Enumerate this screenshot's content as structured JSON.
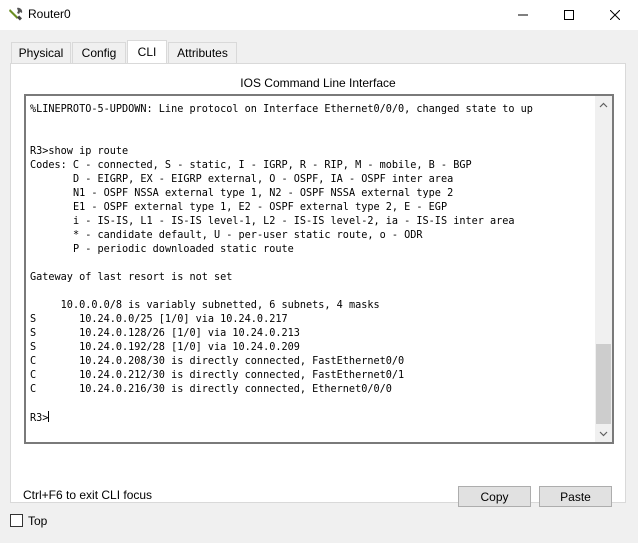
{
  "window": {
    "title": "Router0"
  },
  "tabs": [
    {
      "label": "Physical"
    },
    {
      "label": "Config"
    },
    {
      "label": "CLI"
    },
    {
      "label": "Attributes"
    }
  ],
  "active_tab": "CLI",
  "panel": {
    "title": "IOS Command Line Interface"
  },
  "terminal": {
    "output": "%LINEPROTO-5-UPDOWN: Line protocol on Interface Ethernet0/0/0, changed state to up\n\n\nR3>show ip route\nCodes: C - connected, S - static, I - IGRP, R - RIP, M - mobile, B - BGP\n       D - EIGRP, EX - EIGRP external, O - OSPF, IA - OSPF inter area\n       N1 - OSPF NSSA external type 1, N2 - OSPF NSSA external type 2\n       E1 - OSPF external type 1, E2 - OSPF external type 2, E - EGP\n       i - IS-IS, L1 - IS-IS level-1, L2 - IS-IS level-2, ia - IS-IS inter area\n       * - candidate default, U - per-user static route, o - ODR\n       P - periodic downloaded static route\n\nGateway of last resort is not set\n\n     10.0.0.0/8 is variably subnetted, 6 subnets, 4 masks\nS       10.24.0.0/25 [1/0] via 10.24.0.217\nS       10.24.0.128/26 [1/0] via 10.24.0.213\nS       10.24.0.192/28 [1/0] via 10.24.0.209\nC       10.24.0.208/30 is directly connected, FastEthernet0/0\nC       10.24.0.212/30 is directly connected, FastEthernet0/1\nC       10.24.0.216/30 is directly connected, Ethernet0/0/0\n\n",
    "prompt": "R3>",
    "scroll_position": 0.95
  },
  "footer": {
    "focus_hint": "Ctrl+F6 to exit CLI focus",
    "copy_label": "Copy",
    "paste_label": "Paste"
  },
  "top_checkbox": {
    "label": "Top",
    "checked": false
  },
  "icons": {
    "app": "router-config-icon",
    "minimize": "minimize-icon",
    "maximize": "maximize-icon",
    "close": "close-icon"
  }
}
